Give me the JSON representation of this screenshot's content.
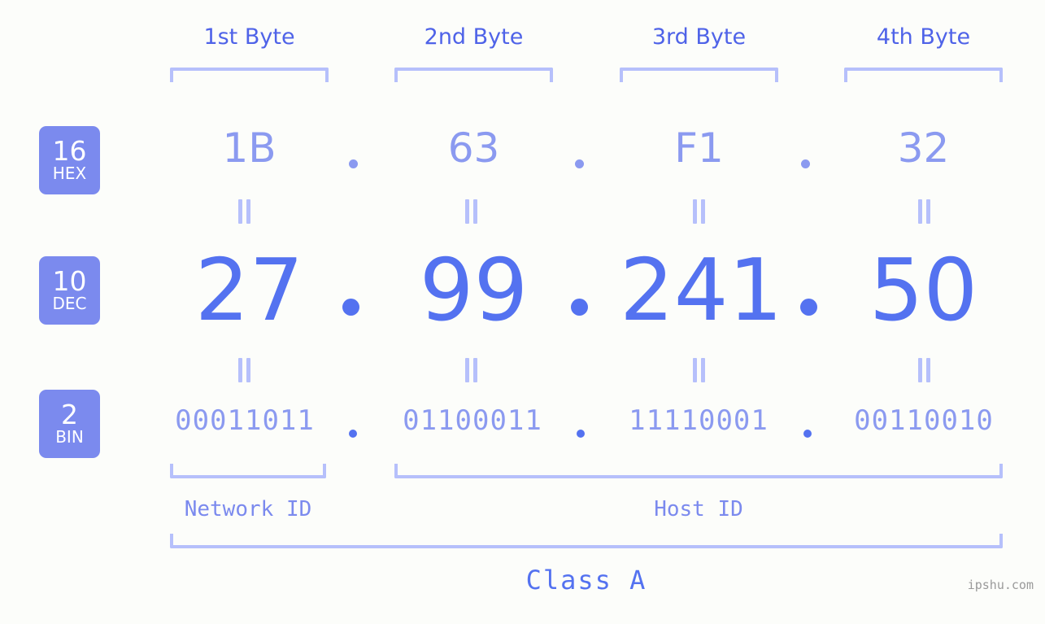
{
  "diagram": {
    "title": "IP address byte breakdown",
    "background_color": "#fcfdfa",
    "accent_color": "#5472f0",
    "light_accent_color": "#8b9af0",
    "bracket_color": "#b6c0fb",
    "badge_color": "#7b8aee"
  },
  "byte_headers": [
    {
      "label": "1st Byte"
    },
    {
      "label": "2nd Byte"
    },
    {
      "label": "3rd Byte"
    },
    {
      "label": "4th Byte"
    }
  ],
  "rows": {
    "hex": {
      "badge_number": "16",
      "badge_name": "HEX",
      "values": [
        "1B",
        "63",
        "F1",
        "32"
      ],
      "separator": "."
    },
    "dec": {
      "badge_number": "10",
      "badge_name": "DEC",
      "values": [
        "27",
        "99",
        "241",
        "50"
      ],
      "separator": "."
    },
    "bin": {
      "badge_number": "2",
      "badge_name": "BIN",
      "values": [
        "00011011",
        "01100011",
        "11110001",
        "00110010"
      ],
      "separator": "."
    }
  },
  "equals_marks": {
    "symbol": "="
  },
  "id_sections": [
    {
      "label": "Network ID"
    },
    {
      "label": "Host ID"
    }
  ],
  "class_label": "Class A",
  "watermark": "ipshu.com"
}
